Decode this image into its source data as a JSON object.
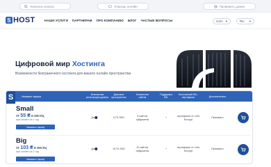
{
  "topbar": {
    "search_placeholder": "Написать вопрос",
    "chat_label": "Помощь онлайн",
    "domain_label": "Проверить домен"
  },
  "header": {
    "logo_mark": "S",
    "logo_text": "HOST",
    "nav": [
      "НАШИ УСЛУГИ",
      "ПАРТНЕРАМ",
      "ПРО КОМПАНИЮ",
      "БЛОГ",
      "ЧАСТЫЕ ВОПРОСЫ"
    ],
    "currency": "UAH",
    "language": "RU"
  },
  "hero": {
    "title_main": "Цифровой мир",
    "title_accent": "Хостинга",
    "subtitle": "Возможности безграничного хостинга для вашего онлайн пространства"
  },
  "table": {
    "logo": "S",
    "columns": [
      "Название тарифа",
      "Бесплатная регистрация домена",
      "Дисковое пространство",
      "Количество сайтов",
      "Поддержка SSL",
      "Бесплатный SSL-сертификат",
      "Дополнительно"
    ],
    "plans": [
      {
        "name": "Small",
        "price_prefix": "от",
        "price": "55 ₴",
        "price_suffix": "в месяц",
        "per_note": "при оплате на 1 год",
        "order": "Заказать тариф",
        "domain": "Да",
        "disk": "5 ГБ SSD",
        "sites": "5 сайтов, субдомены",
        "ssl": "+",
        "free_ssl": "сертификат от Let's Encrypt",
        "extra": "Приказать"
      },
      {
        "name": "Big",
        "price_prefix": "от",
        "price": "103 ₴",
        "price_suffix": "в месяц",
        "per_note": "при оплате на 1 год",
        "order": "Заказать тариф",
        "domain": "Да",
        "disk": "15 ГБ SSD",
        "sites": "10 сайтов, субдомены",
        "ssl": "+",
        "free_ssl": "сертификат от Let's Encrypt",
        "extra": "Приказать"
      }
    ]
  },
  "colors": {
    "accent": "#2e63b8",
    "brand_dark": "#1f4e9c"
  }
}
